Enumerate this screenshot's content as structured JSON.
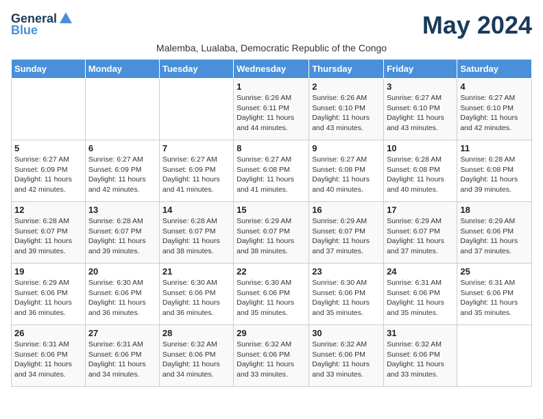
{
  "header": {
    "logo_general": "General",
    "logo_blue": "Blue",
    "month_title": "May 2024",
    "subtitle": "Malemba, Lualaba, Democratic Republic of the Congo"
  },
  "days_of_week": [
    "Sunday",
    "Monday",
    "Tuesday",
    "Wednesday",
    "Thursday",
    "Friday",
    "Saturday"
  ],
  "weeks": [
    [
      {
        "day": "",
        "info": ""
      },
      {
        "day": "",
        "info": ""
      },
      {
        "day": "",
        "info": ""
      },
      {
        "day": "1",
        "info": "Sunrise: 6:26 AM\nSunset: 6:11 PM\nDaylight: 11 hours and 44 minutes."
      },
      {
        "day": "2",
        "info": "Sunrise: 6:26 AM\nSunset: 6:10 PM\nDaylight: 11 hours and 43 minutes."
      },
      {
        "day": "3",
        "info": "Sunrise: 6:27 AM\nSunset: 6:10 PM\nDaylight: 11 hours and 43 minutes."
      },
      {
        "day": "4",
        "info": "Sunrise: 6:27 AM\nSunset: 6:10 PM\nDaylight: 11 hours and 42 minutes."
      }
    ],
    [
      {
        "day": "5",
        "info": "Sunrise: 6:27 AM\nSunset: 6:09 PM\nDaylight: 11 hours and 42 minutes."
      },
      {
        "day": "6",
        "info": "Sunrise: 6:27 AM\nSunset: 6:09 PM\nDaylight: 11 hours and 42 minutes."
      },
      {
        "day": "7",
        "info": "Sunrise: 6:27 AM\nSunset: 6:09 PM\nDaylight: 11 hours and 41 minutes."
      },
      {
        "day": "8",
        "info": "Sunrise: 6:27 AM\nSunset: 6:08 PM\nDaylight: 11 hours and 41 minutes."
      },
      {
        "day": "9",
        "info": "Sunrise: 6:27 AM\nSunset: 6:08 PM\nDaylight: 11 hours and 40 minutes."
      },
      {
        "day": "10",
        "info": "Sunrise: 6:28 AM\nSunset: 6:08 PM\nDaylight: 11 hours and 40 minutes."
      },
      {
        "day": "11",
        "info": "Sunrise: 6:28 AM\nSunset: 6:08 PM\nDaylight: 11 hours and 39 minutes."
      }
    ],
    [
      {
        "day": "12",
        "info": "Sunrise: 6:28 AM\nSunset: 6:07 PM\nDaylight: 11 hours and 39 minutes."
      },
      {
        "day": "13",
        "info": "Sunrise: 6:28 AM\nSunset: 6:07 PM\nDaylight: 11 hours and 39 minutes."
      },
      {
        "day": "14",
        "info": "Sunrise: 6:28 AM\nSunset: 6:07 PM\nDaylight: 11 hours and 38 minutes."
      },
      {
        "day": "15",
        "info": "Sunrise: 6:29 AM\nSunset: 6:07 PM\nDaylight: 11 hours and 38 minutes."
      },
      {
        "day": "16",
        "info": "Sunrise: 6:29 AM\nSunset: 6:07 PM\nDaylight: 11 hours and 37 minutes."
      },
      {
        "day": "17",
        "info": "Sunrise: 6:29 AM\nSunset: 6:07 PM\nDaylight: 11 hours and 37 minutes."
      },
      {
        "day": "18",
        "info": "Sunrise: 6:29 AM\nSunset: 6:06 PM\nDaylight: 11 hours and 37 minutes."
      }
    ],
    [
      {
        "day": "19",
        "info": "Sunrise: 6:29 AM\nSunset: 6:06 PM\nDaylight: 11 hours and 36 minutes."
      },
      {
        "day": "20",
        "info": "Sunrise: 6:30 AM\nSunset: 6:06 PM\nDaylight: 11 hours and 36 minutes."
      },
      {
        "day": "21",
        "info": "Sunrise: 6:30 AM\nSunset: 6:06 PM\nDaylight: 11 hours and 36 minutes."
      },
      {
        "day": "22",
        "info": "Sunrise: 6:30 AM\nSunset: 6:06 PM\nDaylight: 11 hours and 35 minutes."
      },
      {
        "day": "23",
        "info": "Sunrise: 6:30 AM\nSunset: 6:06 PM\nDaylight: 11 hours and 35 minutes."
      },
      {
        "day": "24",
        "info": "Sunrise: 6:31 AM\nSunset: 6:06 PM\nDaylight: 11 hours and 35 minutes."
      },
      {
        "day": "25",
        "info": "Sunrise: 6:31 AM\nSunset: 6:06 PM\nDaylight: 11 hours and 35 minutes."
      }
    ],
    [
      {
        "day": "26",
        "info": "Sunrise: 6:31 AM\nSunset: 6:06 PM\nDaylight: 11 hours and 34 minutes."
      },
      {
        "day": "27",
        "info": "Sunrise: 6:31 AM\nSunset: 6:06 PM\nDaylight: 11 hours and 34 minutes."
      },
      {
        "day": "28",
        "info": "Sunrise: 6:32 AM\nSunset: 6:06 PM\nDaylight: 11 hours and 34 minutes."
      },
      {
        "day": "29",
        "info": "Sunrise: 6:32 AM\nSunset: 6:06 PM\nDaylight: 11 hours and 33 minutes."
      },
      {
        "day": "30",
        "info": "Sunrise: 6:32 AM\nSunset: 6:06 PM\nDaylight: 11 hours and 33 minutes."
      },
      {
        "day": "31",
        "info": "Sunrise: 6:32 AM\nSunset: 6:06 PM\nDaylight: 11 hours and 33 minutes."
      },
      {
        "day": "",
        "info": ""
      }
    ]
  ]
}
